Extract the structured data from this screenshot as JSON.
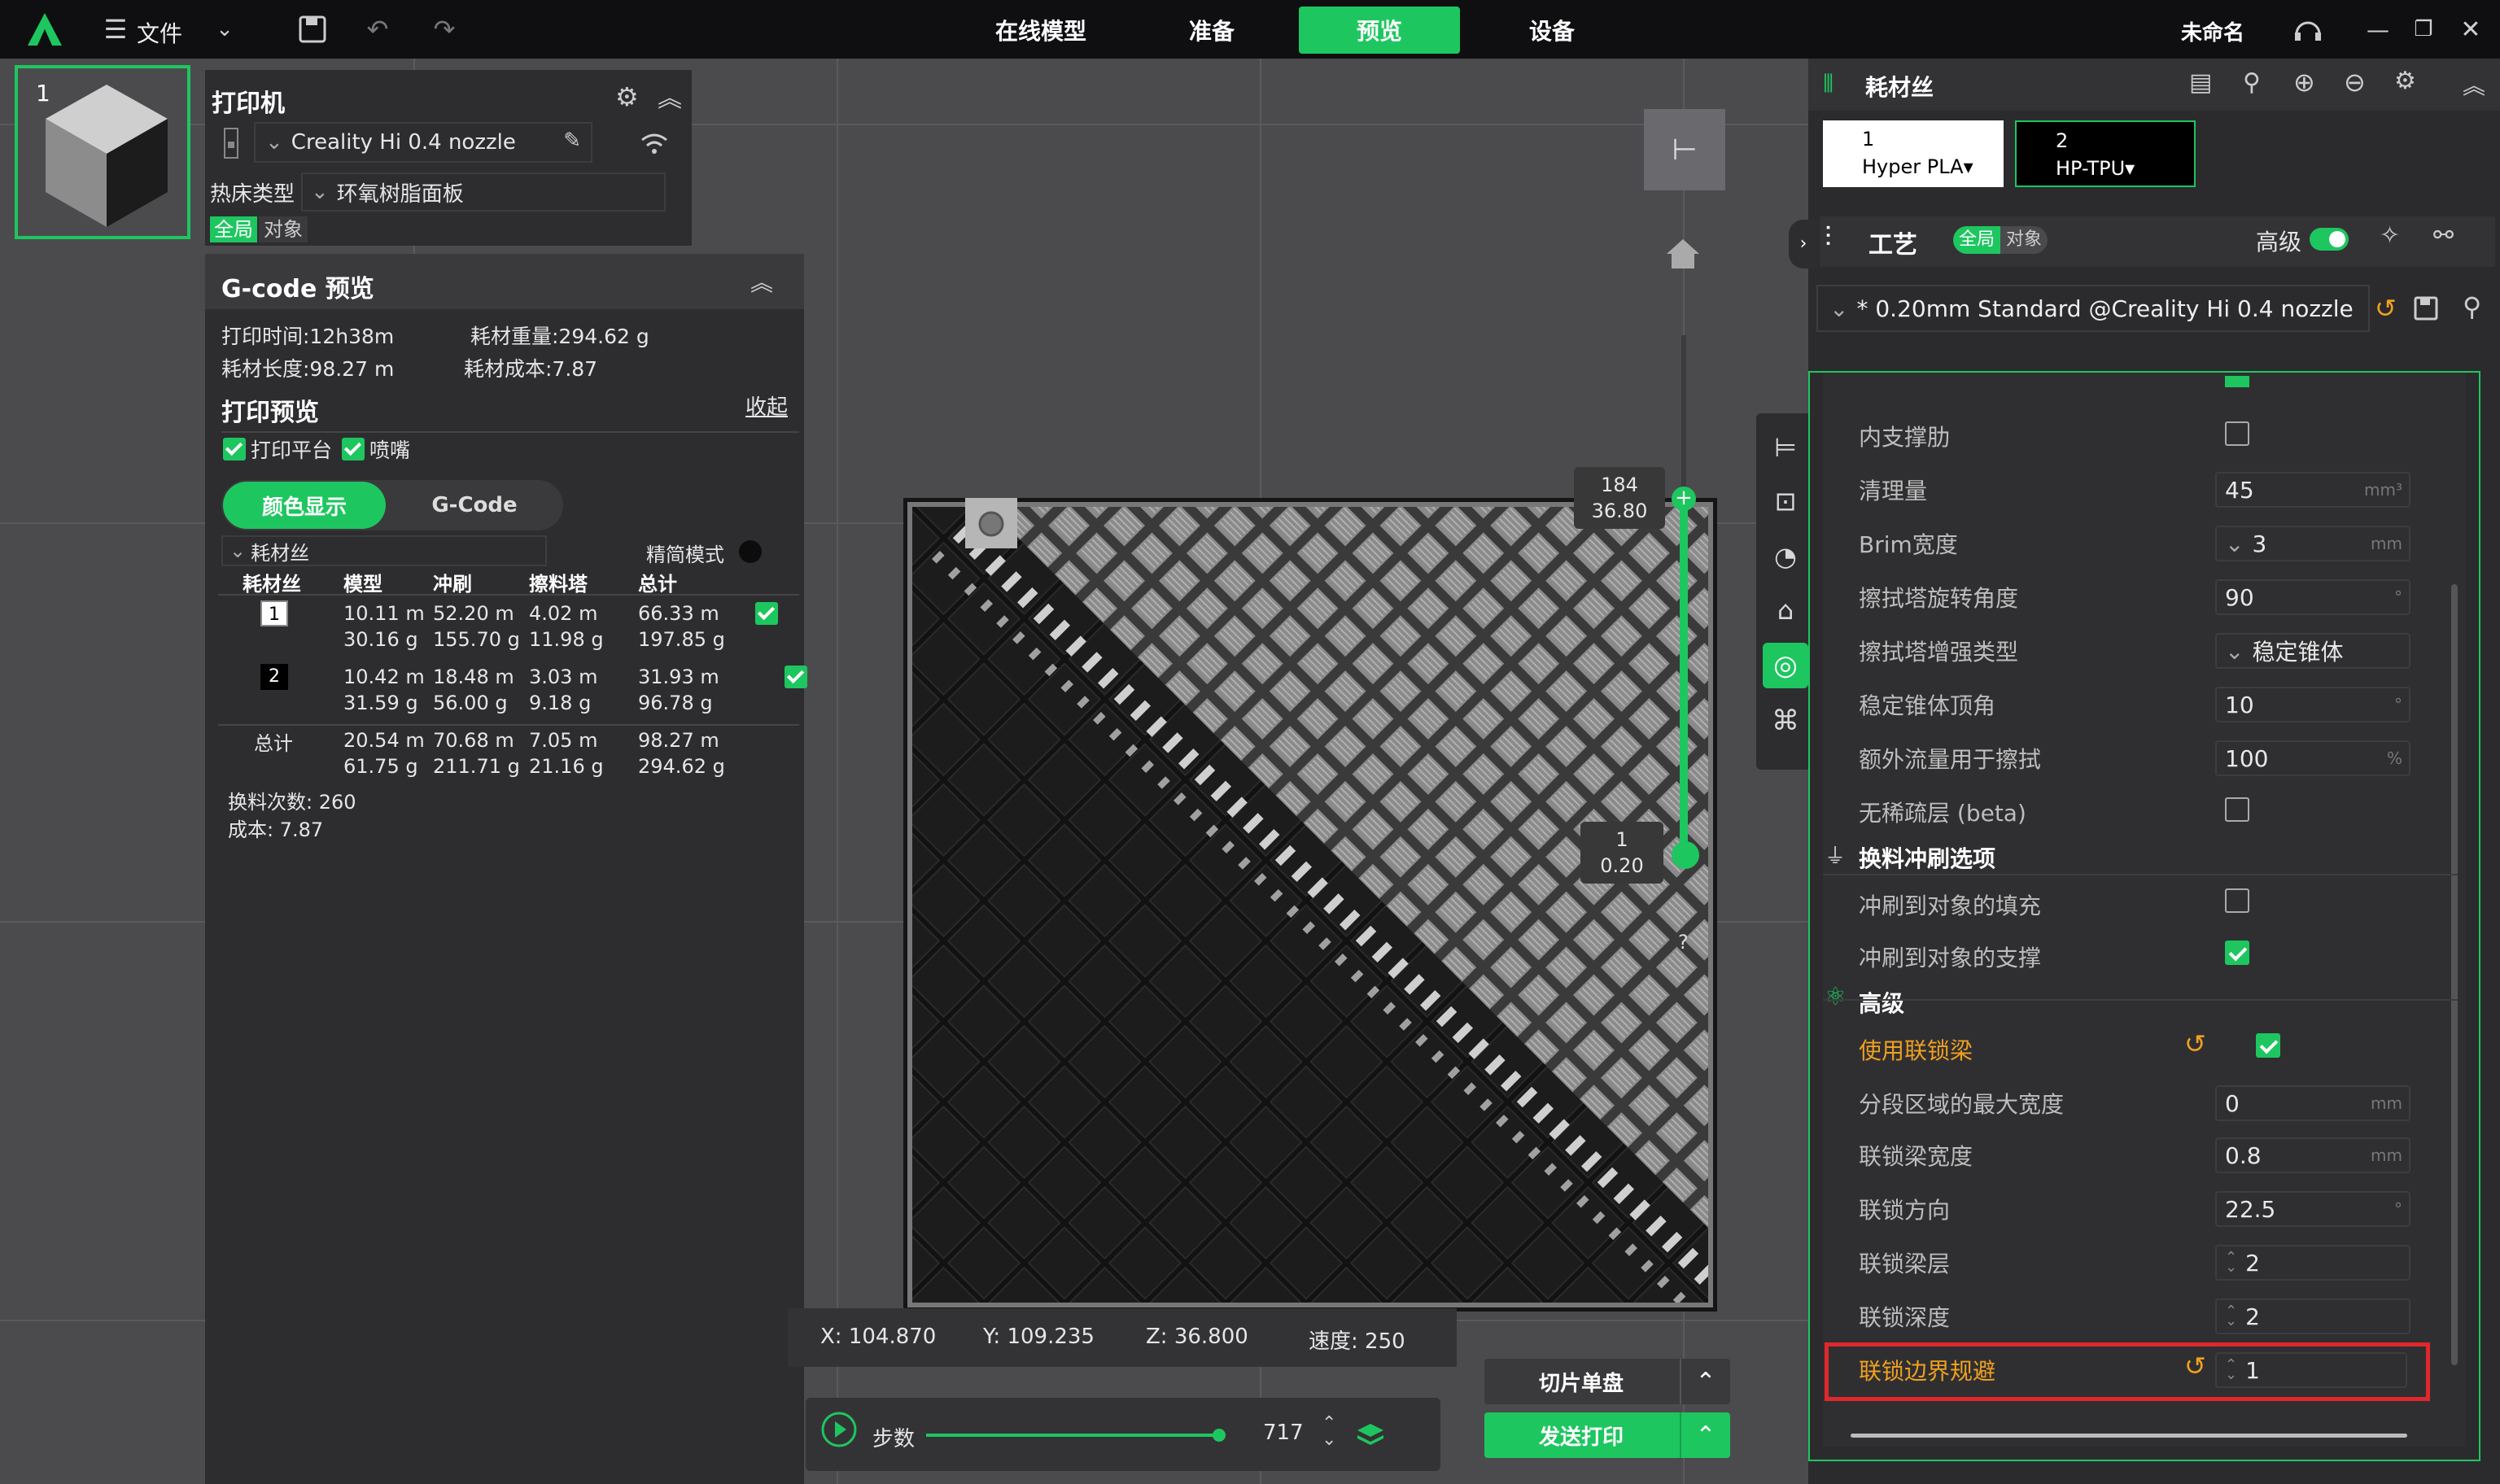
{
  "topbar": {
    "menu_file": "文件",
    "tabs": [
      {
        "label": "在线模型",
        "active": false
      },
      {
        "label": "准备",
        "active": false
      },
      {
        "label": "预览",
        "active": true
      },
      {
        "label": "设备",
        "active": false
      }
    ],
    "project_name": "未命名"
  },
  "plate": {
    "number": "1"
  },
  "printer": {
    "title": "打印机",
    "name": "Creality Hi 0.4 nozzle",
    "bed_label": "热床类型",
    "bed_value": "环氧树脂面板",
    "scope_global": "全局",
    "scope_object": "对象"
  },
  "gcode": {
    "title": "G-code 预览",
    "print_time": "打印时间:12h38m",
    "filament_weight": "耗材重量:294.62 g",
    "filament_length": "耗材长度:98.27 m",
    "filament_cost": "耗材成本:7.87",
    "preview_title": "打印预览",
    "collapse": "收起",
    "show_plate": "打印平台",
    "show_nozzle": "喷嘴",
    "mode_color": "颜色显示",
    "mode_gcode": "G-Code",
    "filament_dropdown": "耗材丝",
    "simple_mode": "精简模式",
    "table_headers": [
      "耗材丝",
      "模型",
      "冲刷",
      "擦料塔",
      "总计"
    ],
    "rows": [
      {
        "id": "1",
        "model": [
          "10.11 m",
          "30.16 g"
        ],
        "flush": [
          "52.20 m",
          "155.70 g"
        ],
        "tower": [
          "4.02 m",
          "11.98 g"
        ],
        "total": [
          "66.33 m",
          "197.85 g"
        ]
      },
      {
        "id": "2",
        "model": [
          "10.42 m",
          "31.59 g"
        ],
        "flush": [
          "18.48 m",
          "56.00 g"
        ],
        "tower": [
          "3.03 m",
          "9.18 g"
        ],
        "total": [
          "31.93 m",
          "96.78 g"
        ]
      }
    ],
    "total_row": {
      "label": "总计",
      "model": [
        "20.54 m",
        "61.75 g"
      ],
      "flush": [
        "70.68 m",
        "211.71 g"
      ],
      "tower": [
        "7.05 m",
        "21.16 g"
      ],
      "total": [
        "98.27 m",
        "294.62 g"
      ]
    },
    "swap_count": "换料次数: 260",
    "cost": "成本: 7.87"
  },
  "layer_slider": {
    "top_layer": "184",
    "top_height": "36.80",
    "bottom_layer": "1",
    "bottom_height": "0.20",
    "help": "?"
  },
  "status": {
    "x": "X: 104.870",
    "y": "Y: 109.235",
    "z": "Z: 36.800",
    "speed": "速度: 250"
  },
  "steps": {
    "label": "步数",
    "value": "717",
    "progress": 1.0
  },
  "buttons": {
    "slice": "切片单盘",
    "send": "发送打印"
  },
  "filament": {
    "title": "耗材丝",
    "slots": [
      {
        "index": "1",
        "name": "Hyper PLA",
        "bg": "#ffffff",
        "fg": "#000000"
      },
      {
        "index": "2",
        "name": "HP-TPU",
        "bg": "#000000",
        "fg": "#ffffff"
      }
    ]
  },
  "process": {
    "title": "工艺",
    "scope_global": "全局",
    "scope_object": "对象",
    "advanced_label": "高级",
    "preset": "* 0.20mm Standard @Creality Hi 0.4 nozzle"
  },
  "settings": {
    "rows": [
      {
        "label": "内支撑肋",
        "type": "check",
        "checked": false
      },
      {
        "label": "清理量",
        "type": "input",
        "value": "45",
        "unit": "mm³"
      },
      {
        "label": "Brim宽度",
        "type": "combo",
        "value": "3",
        "unit": "mm"
      },
      {
        "label": "擦拭塔旋转角度",
        "type": "input",
        "value": "90",
        "unit": "°"
      },
      {
        "label": "擦拭塔增强类型",
        "type": "select",
        "value": "稳定锥体"
      },
      {
        "label": "稳定锥体顶角",
        "type": "input",
        "value": "10",
        "unit": "°"
      },
      {
        "label": "额外流量用于擦拭",
        "type": "input",
        "value": "100",
        "unit": "%"
      },
      {
        "label": "无稀疏层 (beta)",
        "type": "check",
        "checked": false
      }
    ],
    "section_flush": "换料冲刷选项",
    "flush_rows": [
      {
        "label": "冲刷到对象的填充",
        "checked": false
      },
      {
        "label": "冲刷到对象的支撑",
        "checked": true
      }
    ],
    "section_advanced": "高级",
    "adv_rows": [
      {
        "label": "使用联锁梁",
        "type": "check",
        "checked": true,
        "modified": true
      },
      {
        "label": "分段区域的最大宽度",
        "type": "input",
        "value": "0",
        "unit": "mm"
      },
      {
        "label": "联锁梁宽度",
        "type": "input",
        "value": "0.8",
        "unit": "mm"
      },
      {
        "label": "联锁方向",
        "type": "input",
        "value": "22.5",
        "unit": "°"
      },
      {
        "label": "联锁梁层",
        "type": "spin",
        "value": "2"
      },
      {
        "label": "联锁深度",
        "type": "spin",
        "value": "2"
      },
      {
        "label": "联锁边界规避",
        "type": "spin",
        "value": "1",
        "modified": true
      }
    ]
  },
  "colors": {
    "accent": "#1ec65f",
    "modified": "#f0a020",
    "highlight_box": "#e0282c"
  }
}
